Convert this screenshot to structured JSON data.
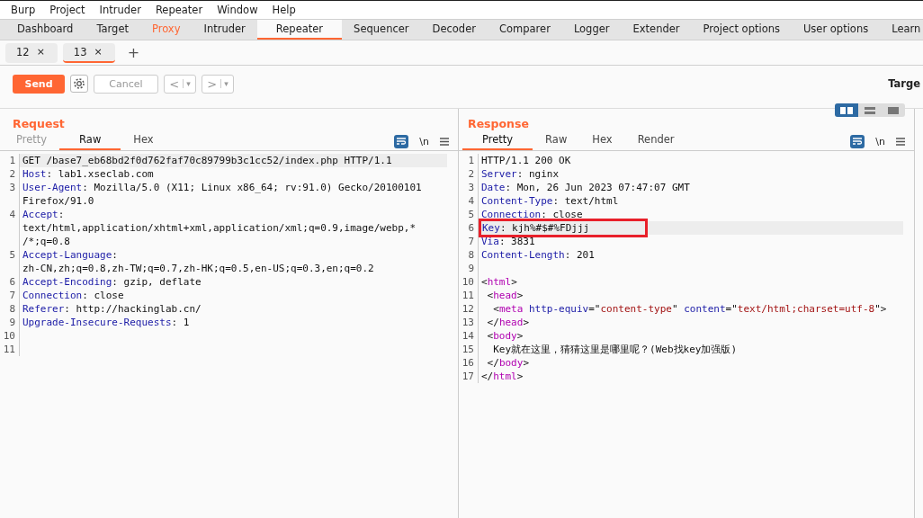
{
  "menu": [
    "Burp",
    "Project",
    "Intruder",
    "Repeater",
    "Window",
    "Help"
  ],
  "tool_tabs": [
    {
      "label": "Dashboard",
      "selected": false,
      "alert": false
    },
    {
      "label": "Target",
      "selected": false,
      "alert": false
    },
    {
      "label": "Proxy",
      "selected": false,
      "alert": true
    },
    {
      "label": "Intruder",
      "selected": false,
      "alert": false
    },
    {
      "label": "Repeater",
      "selected": true,
      "alert": false
    },
    {
      "label": "Sequencer",
      "selected": false,
      "alert": false
    },
    {
      "label": "Decoder",
      "selected": false,
      "alert": false
    },
    {
      "label": "Comparer",
      "selected": false,
      "alert": false
    },
    {
      "label": "Logger",
      "selected": false,
      "alert": false
    },
    {
      "label": "Extender",
      "selected": false,
      "alert": false
    },
    {
      "label": "Project options",
      "selected": false,
      "alert": false
    },
    {
      "label": "User options",
      "selected": false,
      "alert": false
    },
    {
      "label": "Learn",
      "selected": false,
      "alert": false
    }
  ],
  "repeater_tabs": [
    {
      "label": "12",
      "close": "×",
      "selected": false
    },
    {
      "label": "13",
      "close": "×",
      "selected": true
    }
  ],
  "new_tab": "+",
  "toolbar": {
    "send": "Send",
    "cancel": {
      "label": "Cancel",
      "disabled": true
    },
    "back": "<",
    "forward": ">",
    "dropdown": "▾",
    "target_label": "Targe"
  },
  "panes": [
    {
      "title": "Request",
      "tabs": [
        {
          "label": "Pretty",
          "selected": false,
          "disabled": true
        },
        {
          "label": "Raw",
          "selected": true,
          "disabled": false
        },
        {
          "label": "Hex",
          "selected": false,
          "disabled": false
        }
      ],
      "newline_toggle": "\\n",
      "lines": [
        {
          "number": "1",
          "current": true,
          "marked": false,
          "parts": [
            {
              "kind": "plain",
              "text": "GET /base7_eb68bd2f0d762faf70c89799b3c1cc52/index.php HTTP/1.1"
            }
          ]
        },
        {
          "number": "2",
          "current": false,
          "marked": false,
          "parts": [
            {
              "kind": "name",
              "text": "Host"
            },
            {
              "kind": "plain",
              "text": ": lab1.xseclab.com"
            }
          ]
        },
        {
          "number": "3",
          "current": false,
          "marked": false,
          "parts": [
            {
              "kind": "name",
              "text": "User-Agent"
            },
            {
              "kind": "plain",
              "text": ": Mozilla/5.0 (X11; Linux x86_64; rv:91.0) Gecko/20100101"
            }
          ]
        },
        {
          "current": false,
          "marked": false,
          "parts": [
            {
              "kind": "plain",
              "text": "Firefox/91.0"
            }
          ]
        },
        {
          "number": "4",
          "current": false,
          "marked": false,
          "parts": [
            {
              "kind": "name",
              "text": "Accept"
            },
            {
              "kind": "plain",
              "text": ":"
            }
          ]
        },
        {
          "current": false,
          "marked": false,
          "parts": [
            {
              "kind": "plain",
              "text": "text/html,application/xhtml+xml,application/xml;q=0.9,image/webp,*"
            }
          ]
        },
        {
          "current": false,
          "marked": false,
          "parts": [
            {
              "kind": "plain",
              "text": "/*;q=0.8"
            }
          ]
        },
        {
          "number": "5",
          "current": false,
          "marked": false,
          "parts": [
            {
              "kind": "name",
              "text": "Accept-Language"
            },
            {
              "kind": "plain",
              "text": ":"
            }
          ]
        },
        {
          "current": false,
          "marked": false,
          "parts": [
            {
              "kind": "plain",
              "text": "zh-CN,zh;q=0.8,zh-TW;q=0.7,zh-HK;q=0.5,en-US;q=0.3,en;q=0.2"
            }
          ]
        },
        {
          "number": "6",
          "current": false,
          "marked": false,
          "parts": [
            {
              "kind": "name",
              "text": "Accept-Encoding"
            },
            {
              "kind": "plain",
              "text": ": gzip, deflate"
            }
          ]
        },
        {
          "number": "7",
          "current": false,
          "marked": false,
          "parts": [
            {
              "kind": "name",
              "text": "Connection"
            },
            {
              "kind": "plain",
              "text": ": close"
            }
          ]
        },
        {
          "number": "8",
          "current": false,
          "marked": false,
          "parts": [
            {
              "kind": "name",
              "text": "Referer"
            },
            {
              "kind": "plain",
              "text": ": http://hackinglab.cn/"
            }
          ]
        },
        {
          "number": "9",
          "current": false,
          "marked": false,
          "parts": [
            {
              "kind": "name",
              "text": "Upgrade-Insecure-Requests"
            },
            {
              "kind": "plain",
              "text": ": 1"
            }
          ]
        },
        {
          "number": "10",
          "current": false,
          "marked": false
        },
        {
          "number": "11",
          "current": false,
          "marked": false
        }
      ]
    },
    {
      "title": "Response",
      "tabs": [
        {
          "label": "Pretty",
          "selected": true,
          "disabled": false
        },
        {
          "label": "Raw",
          "selected": false,
          "disabled": false
        },
        {
          "label": "Hex",
          "selected": false,
          "disabled": false
        },
        {
          "label": "Render",
          "selected": false,
          "disabled": false
        }
      ],
      "newline_toggle": "\\n",
      "lines": [
        {
          "number": "1",
          "current": false,
          "marked": false,
          "parts": [
            {
              "kind": "plain",
              "text": "HTTP/1.1 200 OK"
            }
          ]
        },
        {
          "number": "2",
          "current": false,
          "marked": false,
          "parts": [
            {
              "kind": "name",
              "text": "Server"
            },
            {
              "kind": "plain",
              "text": ": nginx"
            }
          ]
        },
        {
          "number": "3",
          "current": false,
          "marked": false,
          "parts": [
            {
              "kind": "name",
              "text": "Date"
            },
            {
              "kind": "plain",
              "text": ": Mon, 26 Jun 2023 07:47:07 GMT"
            }
          ]
        },
        {
          "number": "4",
          "current": false,
          "marked": false,
          "parts": [
            {
              "kind": "name",
              "text": "Content-Type"
            },
            {
              "kind": "plain",
              "text": ": text/html"
            }
          ]
        },
        {
          "number": "5",
          "current": false,
          "marked": false,
          "parts": [
            {
              "kind": "name",
              "text": "Connection"
            },
            {
              "kind": "plain",
              "text": ": close"
            }
          ]
        },
        {
          "number": "6",
          "current": true,
          "marked": true,
          "parts": [
            {
              "kind": "name",
              "text": "Key"
            },
            {
              "kind": "plain",
              "text": ": kjh%#$#%FDjjj"
            }
          ]
        },
        {
          "number": "7",
          "current": false,
          "marked": false,
          "parts": [
            {
              "kind": "name",
              "text": "Via"
            },
            {
              "kind": "plain",
              "text": ": 3831"
            }
          ]
        },
        {
          "number": "8",
          "current": false,
          "marked": false,
          "parts": [
            {
              "kind": "name",
              "text": "Content-Length"
            },
            {
              "kind": "plain",
              "text": ": 201"
            }
          ]
        },
        {
          "number": "9",
          "current": false,
          "marked": false
        },
        {
          "number": "10",
          "current": false,
          "marked": false,
          "parts": [
            {
              "kind": "plain",
              "text": "<"
            },
            {
              "kind": "tag",
              "text": "html"
            },
            {
              "kind": "plain",
              "text": ">"
            }
          ]
        },
        {
          "number": "11",
          "current": false,
          "marked": false,
          "parts": [
            {
              "kind": "plain",
              "text": " <"
            },
            {
              "kind": "tag",
              "text": "head"
            },
            {
              "kind": "plain",
              "text": ">"
            }
          ]
        },
        {
          "number": "12",
          "current": false,
          "marked": false,
          "parts": [
            {
              "kind": "plain",
              "text": "  <"
            },
            {
              "kind": "tag",
              "text": "meta"
            },
            {
              "kind": "name",
              "text": " http-equiv"
            },
            {
              "kind": "plain",
              "text": "=\""
            },
            {
              "kind": "string",
              "text": "content-type"
            },
            {
              "kind": "plain",
              "text": "\" "
            },
            {
              "kind": "name",
              "text": "content"
            },
            {
              "kind": "plain",
              "text": "=\""
            },
            {
              "kind": "string",
              "text": "text/html;charset=utf-8"
            },
            {
              "kind": "plain",
              "text": "\">"
            }
          ]
        },
        {
          "number": "13",
          "current": false,
          "marked": false,
          "parts": [
            {
              "kind": "plain",
              "text": " </"
            },
            {
              "kind": "tag",
              "text": "head"
            },
            {
              "kind": "plain",
              "text": ">"
            }
          ]
        },
        {
          "number": "14",
          "current": false,
          "marked": false,
          "parts": [
            {
              "kind": "plain",
              "text": " <"
            },
            {
              "kind": "tag",
              "text": "body"
            },
            {
              "kind": "plain",
              "text": ">"
            }
          ]
        },
        {
          "number": "15",
          "current": false,
          "marked": false,
          "parts": [
            {
              "kind": "plain",
              "text": "  Key就在这里，猜猜这里是哪里呢？(Web找key加强版)"
            }
          ]
        },
        {
          "number": "16",
          "current": false,
          "marked": false,
          "parts": [
            {
              "kind": "plain",
              "text": " </"
            },
            {
              "kind": "tag",
              "text": "body"
            },
            {
              "kind": "plain",
              "text": ">"
            }
          ]
        },
        {
          "number": "17",
          "current": false,
          "marked": false,
          "parts": [
            {
              "kind": "plain",
              "text": "</"
            },
            {
              "kind": "tag",
              "text": "html"
            },
            {
              "kind": "plain",
              "text": ">"
            }
          ]
        }
      ]
    }
  ]
}
